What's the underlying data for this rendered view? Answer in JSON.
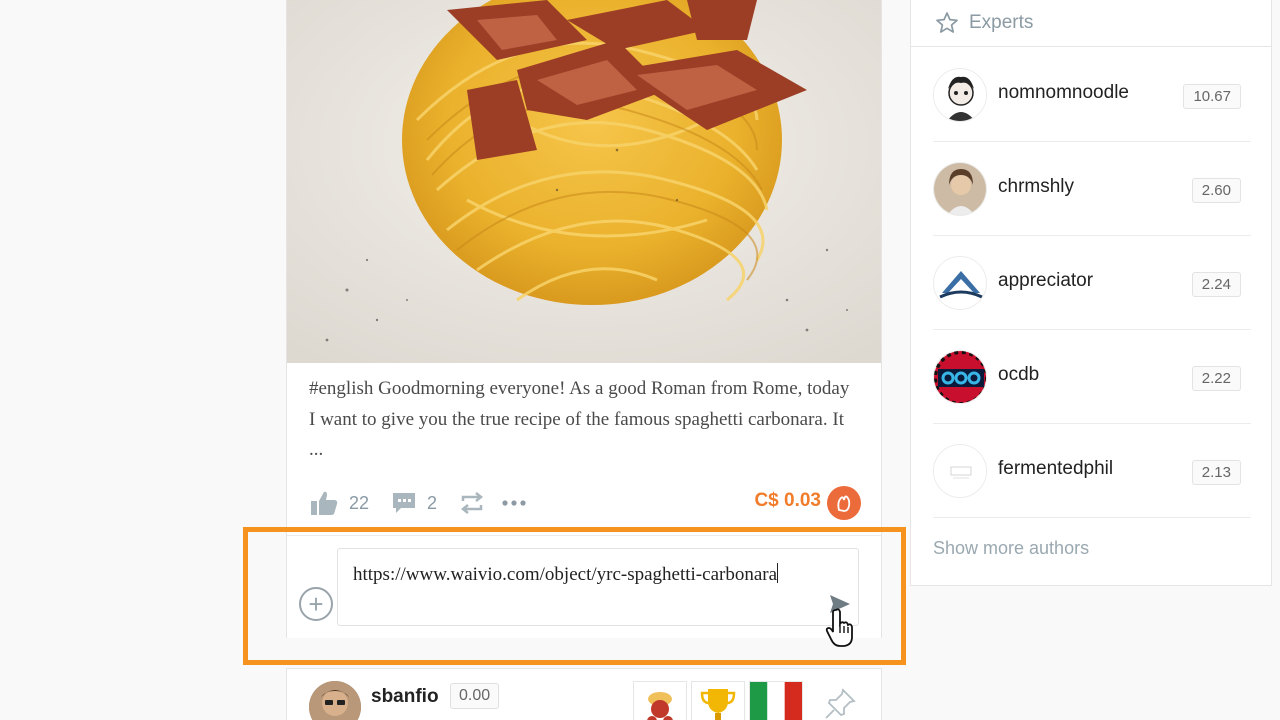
{
  "post": {
    "image_alt": "spaghetti carbonara photo",
    "text": "#english Goodmorning everyone! As a good Roman from Rome, today I want to give you the true recipe of the famous spaghetti carbonara. It ...",
    "likes": "22",
    "comments": "2",
    "payout": "C$ 0.03"
  },
  "comment_box": {
    "value": "https://www.waivio.com/object/yrc-spaghetti-carbonara",
    "add_label": "+"
  },
  "next_post": {
    "author": "sbanfio",
    "score": "0.00"
  },
  "experts": {
    "title": "Experts",
    "items": [
      {
        "name": "nomnomnoodle",
        "score": "10.67"
      },
      {
        "name": "chrmshly",
        "score": "2.60"
      },
      {
        "name": "appreciator",
        "score": "2.24"
      },
      {
        "name": "ocdb",
        "score": "2.22"
      },
      {
        "name": "fermentedphil",
        "score": "2.13"
      }
    ],
    "show_more": "Show more authors"
  },
  "colors": {
    "highlight": "#f6921e",
    "payout": "#f17c2b",
    "icon_grey": "#99aab5"
  }
}
